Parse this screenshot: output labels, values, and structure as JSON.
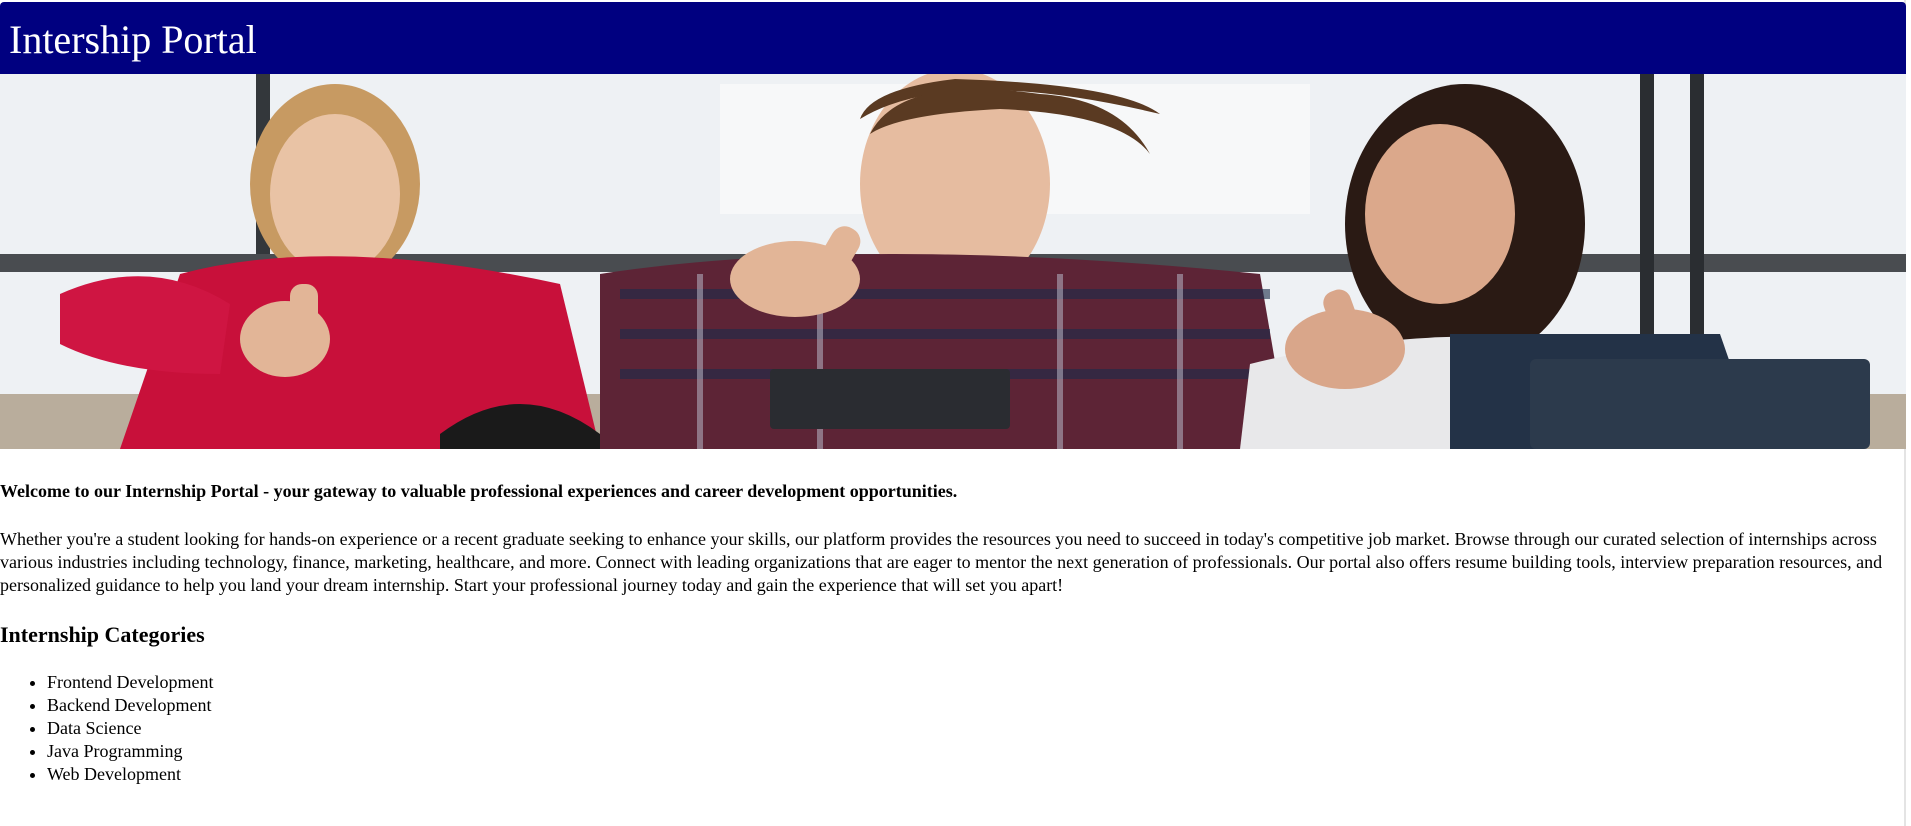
{
  "header": {
    "title": "Intership Portal",
    "background_color": "#000080"
  },
  "hero": {
    "image_description_icon": "photo-of-three-students-thumbs-up"
  },
  "content": {
    "intro": "Welcome to our Internship Portal - your gateway to valuable professional experiences and career development opportunities.",
    "description": "Whether you're a student looking for hands-on experience or a recent graduate seeking to enhance your skills, our platform provides the resources you need to succeed in today's competitive job market. Browse through our curated selection of internships across various industries including technology, finance, marketing, healthcare, and more. Connect with leading organizations that are eager to mentor the next generation of professionals. Our portal also offers resume building tools, interview preparation resources, and personalized guidance to help you land your dream internship. Start your professional journey today and gain the experience that will set you apart!",
    "categories_title": "Internship Categories",
    "categories": [
      "Frontend Development",
      "Backend Development",
      "Data Science",
      "Java Programming",
      "Web Development"
    ]
  }
}
